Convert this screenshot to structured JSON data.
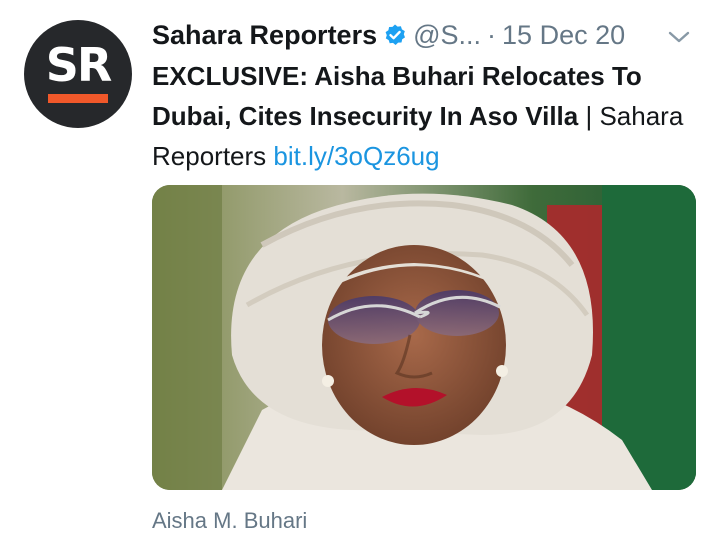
{
  "account": {
    "display_name": "Sahara Reporters",
    "handle": "@S...",
    "separator": "·",
    "date": "15 Dec 20",
    "avatar_text": "SR",
    "verified": true
  },
  "tweet": {
    "headline": "EXCLUSIVE: Aisha Buhari Relocates To Dubai, Cites Insecurity In Aso Villa",
    "pipe": " | ",
    "source_text": "Sahara Reporters",
    "link_text": "bit.ly/3oQz6ug"
  },
  "media": {
    "caption": "Aisha M. Buhari"
  },
  "colors": {
    "verified_blue": "#1da1f2",
    "link_blue": "#1b95e0",
    "brand_orange": "#f0582a",
    "avatar_bg": "#26282b",
    "secondary_text": "#657786"
  },
  "icons": {
    "verified": "verified-badge-icon",
    "menu": "chevron-down-icon"
  }
}
